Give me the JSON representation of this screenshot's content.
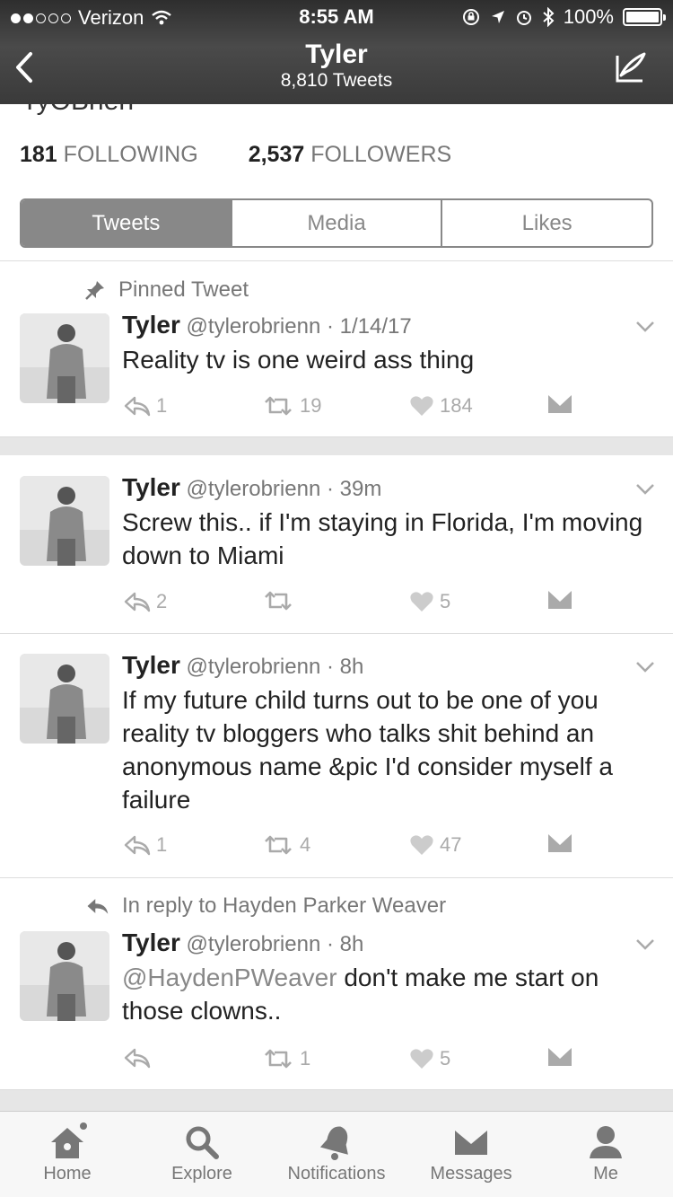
{
  "status": {
    "carrier": "Verizon",
    "time": "8:55 AM",
    "battery": "100%"
  },
  "nav": {
    "title": "Tyler",
    "subtitle": "8,810 Tweets"
  },
  "profile": {
    "cut_handle": "TyOBrien",
    "following_count": "181",
    "following_label": "FOLLOWING",
    "followers_count": "2,537",
    "followers_label": "FOLLOWERS"
  },
  "tabs": [
    {
      "label": "Tweets",
      "active": true
    },
    {
      "label": "Media",
      "active": false
    },
    {
      "label": "Likes",
      "active": false
    }
  ],
  "tweets": [
    {
      "context": "Pinned Tweet",
      "name": "Tyler",
      "handle": "@tylerobrienn",
      "time": "1/14/17",
      "text": "Reality tv is one weird ass thing",
      "replies": "1",
      "retweets": "19",
      "likes": "184"
    },
    {
      "context": "",
      "name": "Tyler",
      "handle": "@tylerobrienn",
      "time": "39m",
      "text": "Screw this.. if I'm staying in Florida, I'm moving down to Miami",
      "replies": "2",
      "retweets": "",
      "likes": "5"
    },
    {
      "context": "",
      "name": "Tyler",
      "handle": "@tylerobrienn",
      "time": "8h",
      "text": "If my future child turns out to be one of you reality tv bloggers who talks shit behind an anonymous name &pic I'd consider myself a failure",
      "replies": "1",
      "retweets": "4",
      "likes": "47"
    },
    {
      "context": "In reply to Hayden Parker Weaver",
      "name": "Tyler",
      "handle": "@tylerobrienn",
      "time": "8h",
      "mention": "@HaydenPWeaver",
      "text": " don't make me start on those clowns..",
      "replies": "",
      "retweets": "1",
      "likes": "5"
    }
  ],
  "tabbar": [
    {
      "label": "Home",
      "icon": "home-icon"
    },
    {
      "label": "Explore",
      "icon": "search-icon"
    },
    {
      "label": "Notifications",
      "icon": "bell-icon"
    },
    {
      "label": "Messages",
      "icon": "envelope-icon"
    },
    {
      "label": "Me",
      "icon": "person-icon"
    }
  ]
}
